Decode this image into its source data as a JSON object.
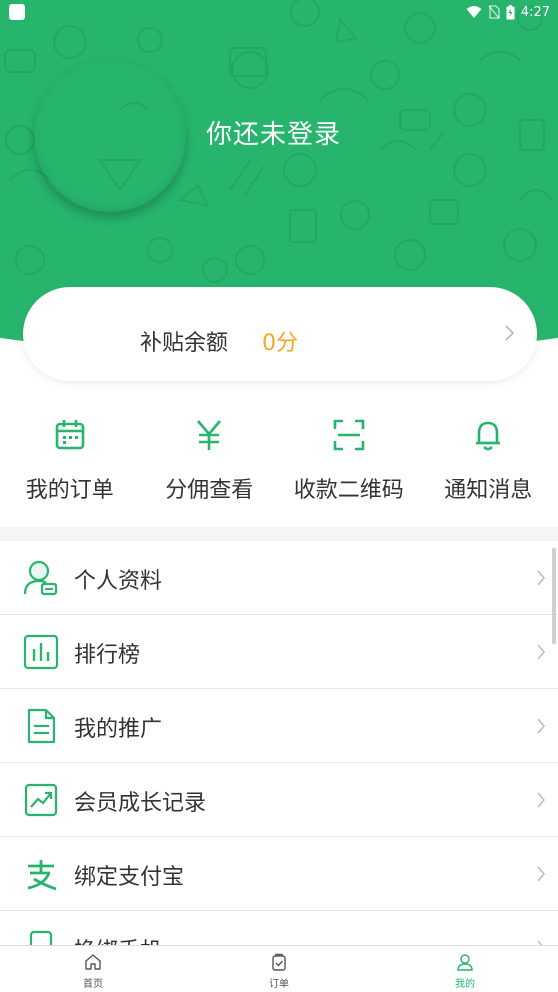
{
  "status_bar": {
    "time": "4:27"
  },
  "profile": {
    "login_prompt": "你还未登录"
  },
  "balance": {
    "label": "补贴余额",
    "value": "0分"
  },
  "quick_actions": [
    {
      "label": "我的订单",
      "icon": "calendar-icon"
    },
    {
      "label": "分佣查看",
      "icon": "yen-icon"
    },
    {
      "label": "收款二维码",
      "icon": "scan-icon"
    },
    {
      "label": "通知消息",
      "icon": "bell-icon"
    }
  ],
  "menu": [
    {
      "label": "个人资料",
      "icon": "profile-card-icon"
    },
    {
      "label": "排行榜",
      "icon": "bar-chart-icon"
    },
    {
      "label": "我的推广",
      "icon": "document-icon"
    },
    {
      "label": "会员成长记录",
      "icon": "trend-icon"
    },
    {
      "label": "绑定支付宝",
      "icon": "alipay-icon"
    },
    {
      "label": "换绑手机",
      "icon": "phone-icon"
    }
  ],
  "tabbar": [
    {
      "label": "首页",
      "icon": "home-icon",
      "active": false
    },
    {
      "label": "订单",
      "icon": "order-bag-icon",
      "active": false
    },
    {
      "label": "我的",
      "icon": "user-icon",
      "active": true
    }
  ],
  "colors": {
    "brand": "#27b56d",
    "accent": "#f5a623"
  }
}
